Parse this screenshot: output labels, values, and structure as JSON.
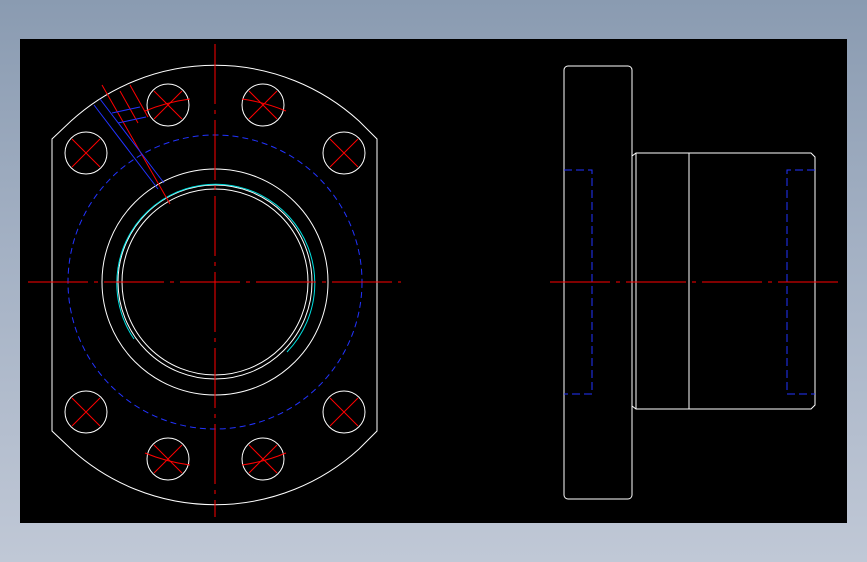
{
  "drawing": {
    "background": "#000000",
    "colors": {
      "outline": "#ffffff",
      "centerline": "#ff0000",
      "hidden": "#0000ff",
      "thread": "#00ffff"
    },
    "views": [
      "front-view",
      "side-view"
    ]
  }
}
